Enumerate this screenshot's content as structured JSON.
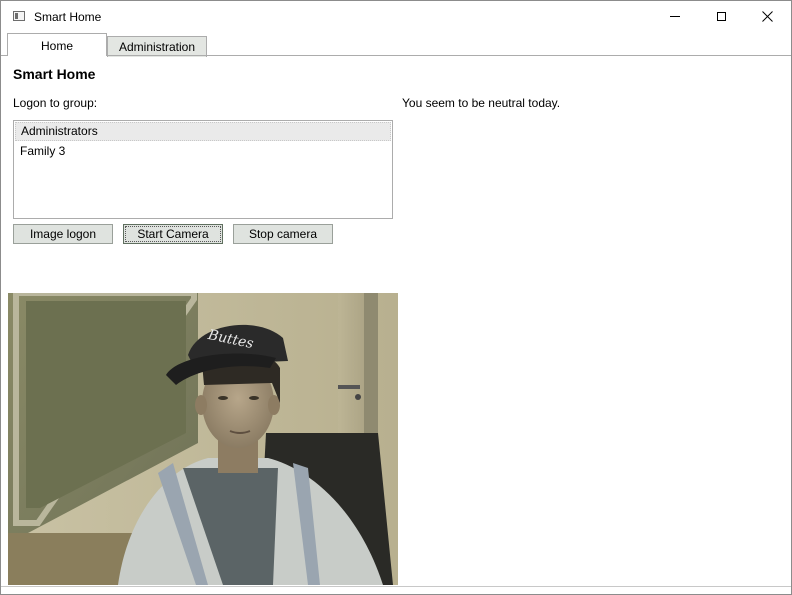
{
  "window": {
    "title": "Smart Home"
  },
  "tabs": [
    {
      "label": "Home",
      "selected": true
    },
    {
      "label": "Administration",
      "selected": false
    }
  ],
  "main": {
    "heading": "Smart Home",
    "group_label": "Logon to group:",
    "mood_text": "You seem to be neutral today.",
    "groups": [
      {
        "label": "Administrators",
        "selected": true
      },
      {
        "label": "Family 3",
        "selected": false
      }
    ],
    "buttons": {
      "image_logon": "Image logon",
      "start_camera": "Start Camera",
      "stop_camera": "Stop camera"
    }
  },
  "icons": {
    "app": "window-app-icon",
    "minimize": "minimize-icon",
    "maximize": "maximize-icon",
    "close": "close-icon"
  },
  "colors": {
    "button_bg": "#dfe3df",
    "inactive_tab_bg": "#e3e6e2",
    "selected_item_bg": "#eaeaea"
  }
}
